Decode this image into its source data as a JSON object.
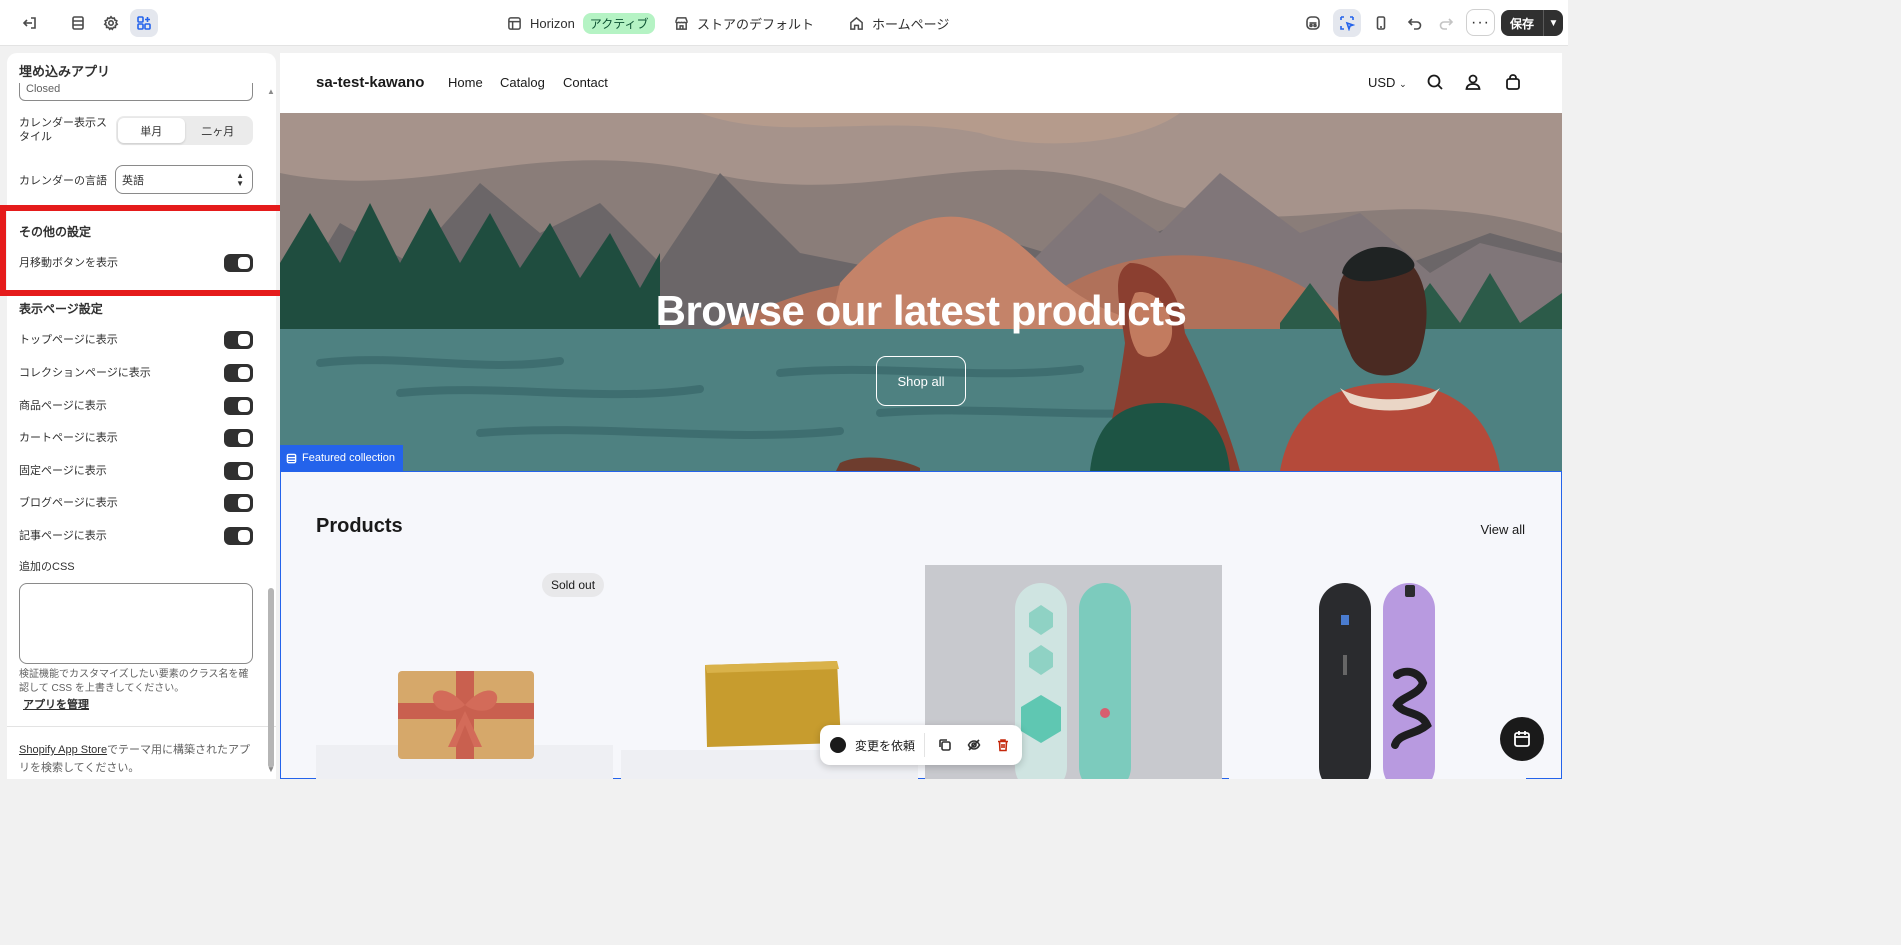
{
  "topbar": {
    "theme_name": "Horizon",
    "theme_status": "アクティブ",
    "store_default": "ストアのデフォルト",
    "homepage": "ホームページ",
    "more": "···",
    "save": "保存"
  },
  "sidebar": {
    "title": "埋め込みアプリ",
    "closed_value": "Closed",
    "calendar_style_label": "カレンダー表示スタイル",
    "calendar_style_options": [
      "単月",
      "二ヶ月"
    ],
    "calendar_lang_label": "カレンダーの言語",
    "calendar_lang_value": "英語",
    "other_settings": {
      "title": "その他の設定",
      "month_nav_label": "月移動ボタンを表示"
    },
    "page_settings": {
      "title": "表示ページ設定",
      "items": [
        "トップページに表示",
        "コレクションページに表示",
        "商品ページに表示",
        "カートページに表示",
        "固定ページに表示",
        "ブログページに表示",
        "記事ページに表示"
      ]
    },
    "css_label": "追加のCSS",
    "css_value": "",
    "help_text": "検証機能でカスタマイズしたい要素のクラス名を確認して CSS を上書きしてください。",
    "manage_link": "アプリを管理",
    "footer_link": "Shopify App Store",
    "footer_text": "でテーマ用に構築されたアプリを検索してください。"
  },
  "preview": {
    "store_name": "sa-test-kawano",
    "nav": [
      "Home",
      "Catalog",
      "Contact"
    ],
    "currency": "USD",
    "hero_title": "Browse our latest products",
    "hero_button": "Shop all",
    "section_tag": "Featured collection",
    "products_title": "Products",
    "view_all": "View all",
    "sold_out": "Sold out",
    "request_changes": "変更を依頼"
  }
}
